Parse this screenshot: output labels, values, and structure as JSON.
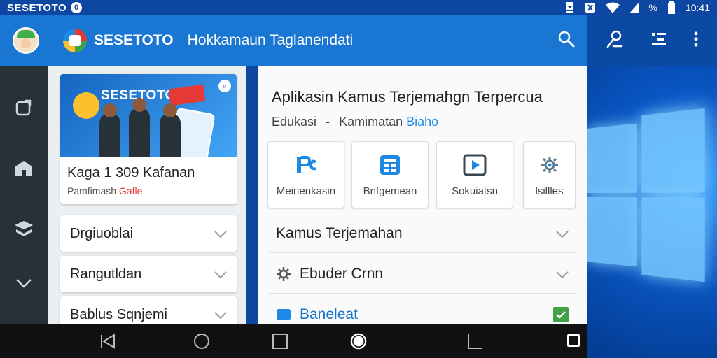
{
  "status_bar": {
    "title": "SESETOTO",
    "badge": "0",
    "battery": "%",
    "time": "10:41"
  },
  "app_bar": {
    "brand": "SESETOTO",
    "title": "Hokkamaun Taglanendati"
  },
  "promo_card": {
    "banner_title": "SESETOTO",
    "title": "Kaga 1 309 Kafanan",
    "subtitle_prefix": "Pamfimash",
    "subtitle_highlight": "Gafle"
  },
  "left_accordions": [
    {
      "label": "Drgiuoblai"
    },
    {
      "label": "Rangutldan"
    },
    {
      "label": "Bablus Sqnjemi"
    }
  ],
  "main": {
    "title": "Aplikasin Kamus Terjemahgn Terpercua",
    "meta_category": "Edukasi",
    "meta_separator": "-",
    "meta_label": "Kamimatan",
    "meta_link": "Biaho",
    "quick_buttons": [
      {
        "label": "Meinenkasin",
        "icon": "translate-icon"
      },
      {
        "label": "Bnfgemean",
        "icon": "grid-icon"
      },
      {
        "label": "Sokuiatsn",
        "icon": "play-icon"
      },
      {
        "label": "lsillles",
        "icon": "gear-icon"
      }
    ],
    "rows": [
      {
        "label": "Kamus Terjemahan"
      },
      {
        "label": "Ebuder Crnn"
      },
      {
        "label": "Baneleat"
      }
    ]
  },
  "colors": {
    "app_bar": "#1976d2",
    "status_bar": "#0d47a1",
    "rail": "#263238",
    "accent_link": "#1e88e5",
    "highlight": "#e53935"
  }
}
